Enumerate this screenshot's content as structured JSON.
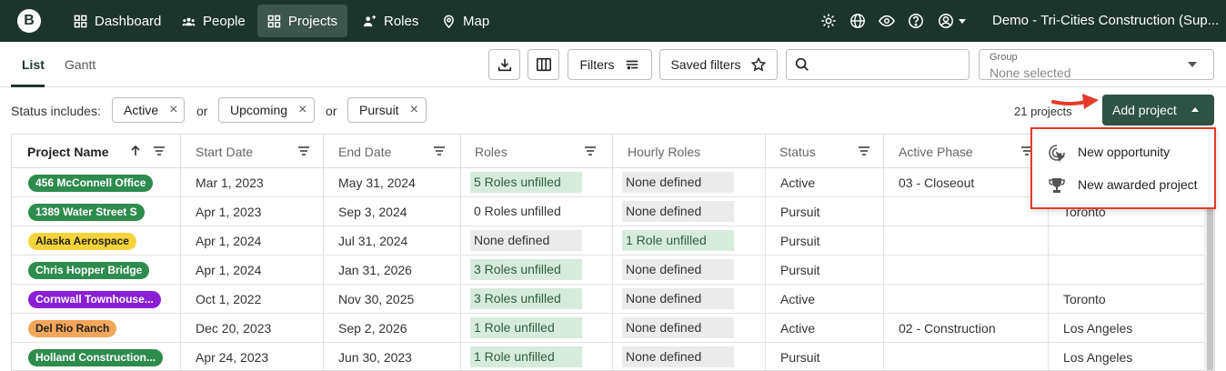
{
  "nav": {
    "logo": "B",
    "items": [
      {
        "label": "Dashboard",
        "icon": "grid-icon"
      },
      {
        "label": "People",
        "icon": "people-icon"
      },
      {
        "label": "Projects",
        "icon": "projects-icon"
      },
      {
        "label": "Roles",
        "icon": "roles-icon"
      },
      {
        "label": "Map",
        "icon": "map-pin-icon"
      }
    ],
    "active": "Projects",
    "org": "Demo - Tri-Cities Construction (Sup..."
  },
  "toolbar": {
    "tabs": [
      "List",
      "Gantt"
    ],
    "active_tab": "List",
    "filters_label": "Filters",
    "saved_filters_label": "Saved filters",
    "search_placeholder": "",
    "group_label": "Group",
    "group_value": "None selected"
  },
  "status": {
    "label": "Status includes:",
    "chips": [
      "Active",
      "Upcoming",
      "Pursuit"
    ],
    "or": "or",
    "count": "21 projects",
    "add_label": "Add project"
  },
  "dropdown": {
    "items": [
      {
        "label": "New opportunity",
        "icon": "opportunity-icon"
      },
      {
        "label": "New awarded project",
        "icon": "trophy-icon"
      }
    ]
  },
  "table": {
    "columns": [
      "Project Name",
      "Start Date",
      "End Date",
      "Roles",
      "Hourly Roles",
      "Status",
      "Active Phase",
      ""
    ],
    "rows": [
      {
        "name": "456 McConnell Office",
        "color": "#2e8b4e",
        "text_color": "#ffffff",
        "start": "Mar 1, 2023",
        "end": "May 31, 2024",
        "roles": "5 Roles unfilled",
        "roles_style": "green",
        "hourly": "None defined",
        "hourly_style": "gray",
        "status": "Active",
        "phase": "03 - Closeout",
        "location": ""
      },
      {
        "name": "1389 Water Street S",
        "color": "#2e8b4e",
        "text_color": "#ffffff",
        "start": "Apr 1, 2023",
        "end": "Sep 3, 2024",
        "roles": "0 Roles unfilled",
        "roles_style": "plain",
        "hourly": "None defined",
        "hourly_style": "gray",
        "status": "Pursuit",
        "phase": "",
        "location": "Toronto"
      },
      {
        "name": "Alaska Aerospace",
        "color": "#f5d33a",
        "text_color": "#222222",
        "start": "Apr 1, 2024",
        "end": "Jul 31, 2024",
        "roles": "None defined",
        "roles_style": "gray",
        "hourly": "1 Role unfilled",
        "hourly_style": "green",
        "status": "Pursuit",
        "phase": "",
        "location": ""
      },
      {
        "name": "Chris Hopper Bridge",
        "color": "#2e8b4e",
        "text_color": "#ffffff",
        "start": "Apr 1, 2024",
        "end": "Jan 31, 2026",
        "roles": "3 Roles unfilled",
        "roles_style": "green",
        "hourly": "None defined",
        "hourly_style": "gray",
        "status": "Pursuit",
        "phase": "",
        "location": ""
      },
      {
        "name": "Cornwall Townhouse...",
        "color": "#8a1fd6",
        "text_color": "#ffffff",
        "start": "Oct 1, 2022",
        "end": "Nov 30, 2025",
        "roles": "3 Roles unfilled",
        "roles_style": "green",
        "hourly": "None defined",
        "hourly_style": "gray",
        "status": "Active",
        "phase": "",
        "location": "Toronto"
      },
      {
        "name": "Del Rio Ranch",
        "color": "#f2a65a",
        "text_color": "#222222",
        "start": "Dec 20, 2023",
        "end": "Sep 2, 2026",
        "roles": "1 Role unfilled",
        "roles_style": "green",
        "hourly": "None defined",
        "hourly_style": "gray",
        "status": "Active",
        "phase": "02 - Construction",
        "location": "Los Angeles"
      },
      {
        "name": "Holland Construction...",
        "color": "#2e8b4e",
        "text_color": "#ffffff",
        "start": "Apr 24, 2023",
        "end": "Jun 30, 2023",
        "roles": "1 Role unfilled",
        "roles_style": "green",
        "hourly": "None defined",
        "hourly_style": "gray",
        "status": "Pursuit",
        "phase": "",
        "location": "Los Angeles"
      }
    ]
  }
}
